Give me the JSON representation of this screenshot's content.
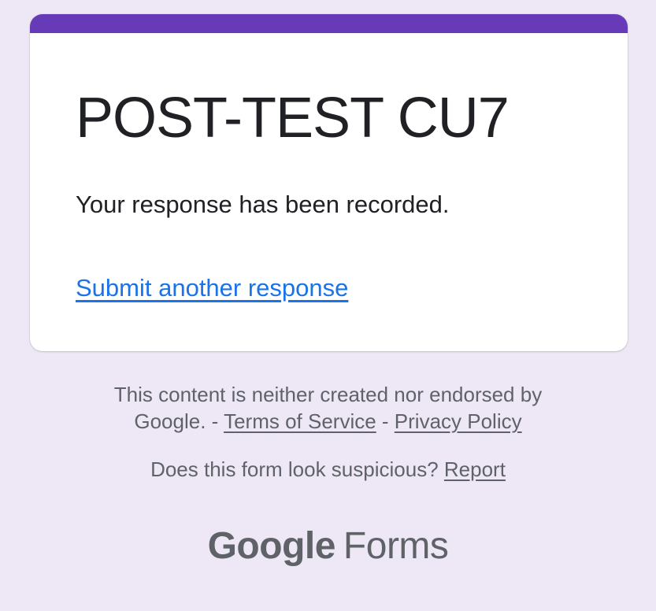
{
  "form": {
    "title": "POST-TEST CU7",
    "confirmation_message": "Your response has been recorded.",
    "submit_another_label": "Submit another response"
  },
  "footer": {
    "disclaimer_line1": "This content is neither created nor endorsed by",
    "disclaimer_line2_prefix": "Google. - ",
    "terms_label": "Terms of Service",
    "separator": " - ",
    "privacy_label": "Privacy Policy",
    "suspicious_prompt": "Does this form look suspicious? ",
    "report_label": "Report"
  },
  "brand": {
    "google": "Google",
    "forms": "Forms"
  },
  "colors": {
    "background": "#ede7f6",
    "accent": "#673ab7",
    "link": "#1a73e8",
    "muted_text": "#5f6368"
  }
}
